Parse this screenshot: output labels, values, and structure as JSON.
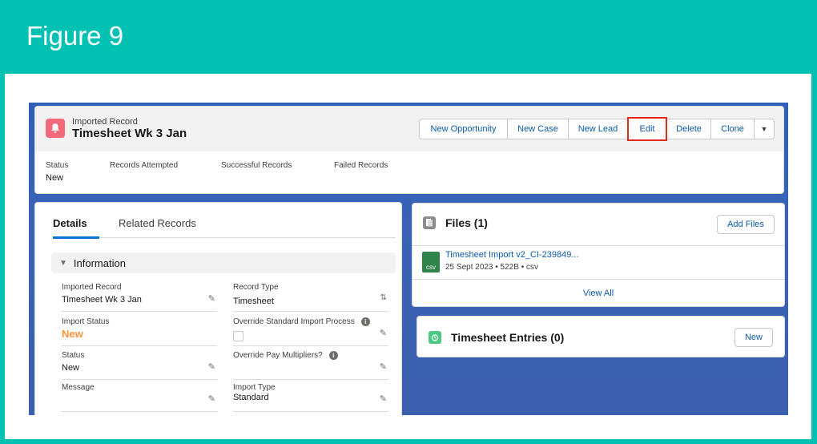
{
  "figure": {
    "title": "Figure 9"
  },
  "record": {
    "object_label": "Imported Record",
    "title": "Timesheet Wk 3 Jan",
    "actions": [
      "New Opportunity",
      "New Case",
      "New Lead",
      "Edit",
      "Delete",
      "Clone"
    ],
    "highlighted_action": "Edit",
    "highlight_color": "#e5281a",
    "header_fields": [
      {
        "label": "Status",
        "value": "New"
      },
      {
        "label": "Records Attempted",
        "value": ""
      },
      {
        "label": "Successful Records",
        "value": ""
      },
      {
        "label": "Failed Records",
        "value": ""
      }
    ]
  },
  "details": {
    "tabs": [
      "Details",
      "Related Records"
    ],
    "active_tab": "Details",
    "section_title": "Information",
    "fields": {
      "imported_record": {
        "label": "Imported Record",
        "value": "Timesheet Wk 3 Jan"
      },
      "record_type": {
        "label": "Record Type",
        "value": "Timesheet"
      },
      "import_status": {
        "label": "Import Status",
        "value": "New"
      },
      "override_standard": {
        "label": "Override Standard Import Process",
        "value": ""
      },
      "status": {
        "label": "Status",
        "value": "New"
      },
      "override_pay": {
        "label": "Override Pay Multipliers?",
        "value": ""
      },
      "message": {
        "label": "Message",
        "value": ""
      },
      "import_type": {
        "label": "Import Type",
        "value": "Standard"
      }
    }
  },
  "files": {
    "title": "Files (1)",
    "add_label": "Add Files",
    "file_name": "Timesheet Import v2_CI-239849...",
    "file_meta": "25 Sept 2023 • 522B • csv",
    "file_type": "csv",
    "view_all": "View All"
  },
  "entries": {
    "title": "Timesheet Entries (0)",
    "new_label": "New"
  },
  "colors": {
    "teal_frame": "#00c1b2",
    "brand_blue": "#0b5cab",
    "accent_orange": "#fe9339"
  }
}
